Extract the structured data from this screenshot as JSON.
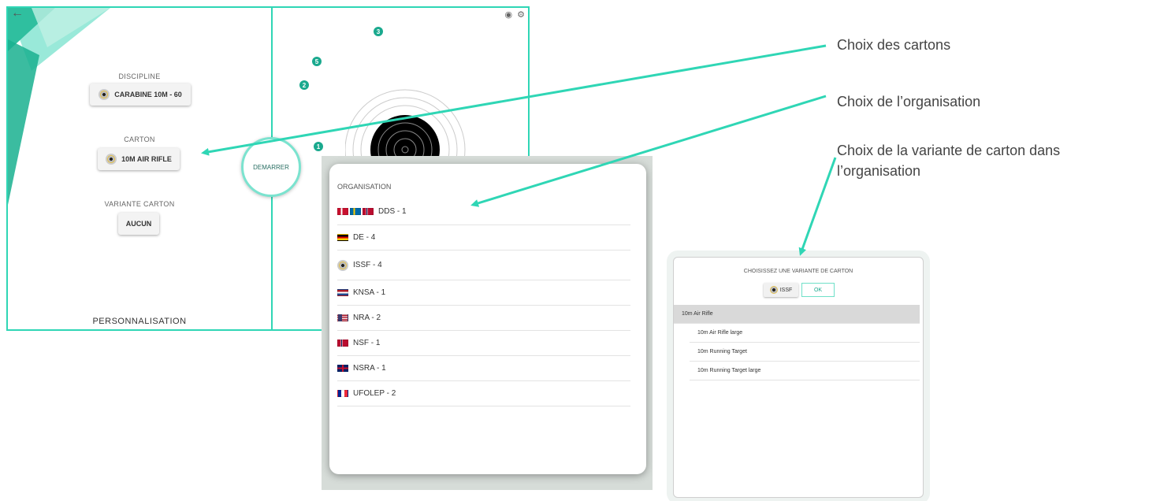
{
  "app": {
    "disciplineLabel": "DISCIPLINE",
    "disciplineValue": "CARABINE 10M - 60",
    "cartonLabel": "CARTON",
    "cartonValue": "10M AIR RIFLE",
    "variantLabel": "VARIANTE CARTON",
    "variantValue": "AUCUN",
    "startButton": "DEMARRER",
    "footer": "PERSONNALISATION",
    "shots": [
      "3",
      "5",
      "2",
      "1"
    ]
  },
  "orgDialog": {
    "header": "ORGANISATION",
    "items": [
      {
        "label": "DDS - 1",
        "flag": "dk-se-no"
      },
      {
        "label": "DE - 4",
        "flag": "de"
      },
      {
        "label": "ISSF - 4",
        "flag": "issf-logo"
      },
      {
        "label": "KNSA - 1",
        "flag": "nl"
      },
      {
        "label": "NRA - 2",
        "flag": "us"
      },
      {
        "label": "NSF - 1",
        "flag": "no"
      },
      {
        "label": "NSRA - 1",
        "flag": "gb"
      },
      {
        "label": "UFOLEP - 2",
        "flag": "fr"
      }
    ]
  },
  "variantDialog": {
    "title": "CHOISISSEZ UNE VARIANTE DE CARTON",
    "org": "ISSF",
    "ok": "OK",
    "items": [
      "10m Air Rifle",
      "10m Air Rifle large",
      "10m Running Target",
      "10m Running Target large"
    ]
  },
  "annotations": {
    "cartons": "Choix des cartons",
    "organisation": "Choix de l’organisation",
    "variant1": "Choix de la variante de carton dans",
    "variant2": "l’organisation"
  },
  "colors": {
    "accent": "#2fd6b5",
    "accentDark": "#1aa98e"
  }
}
